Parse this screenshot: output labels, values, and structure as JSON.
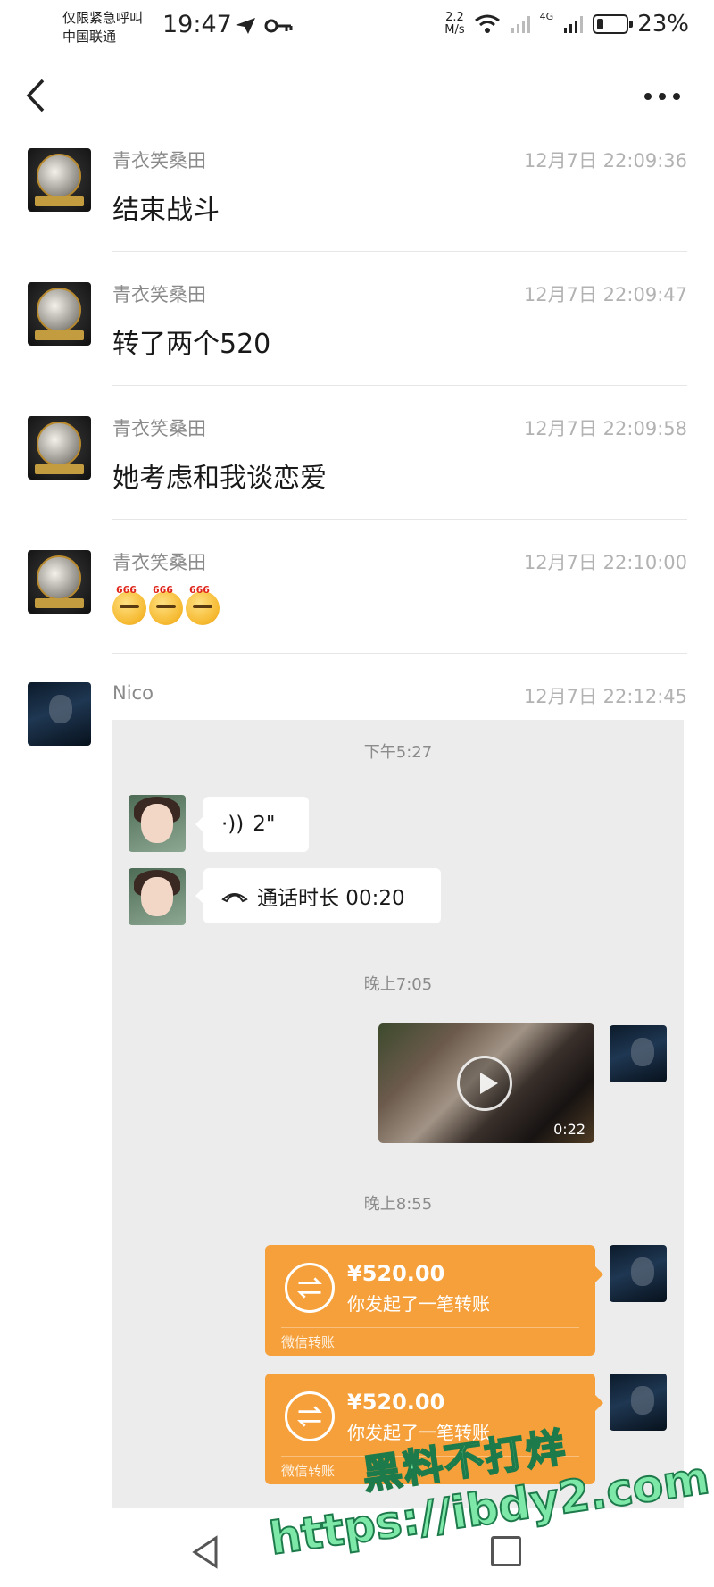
{
  "status_bar": {
    "carrier_line1": "仅限紧急呼叫",
    "carrier_line2": "中国联通",
    "time": "19:47",
    "net_speed_value": "2.2",
    "net_speed_unit": "M/s",
    "network": "4G",
    "battery": "23%",
    "battery_level": 0.23
  },
  "header": {
    "back_icon": "chevron-left-icon",
    "more_icon": "more-horizontal-icon"
  },
  "messages": [
    {
      "sender": "青衣笑桑田",
      "time": "12月7日 22:09:36",
      "text": "结束战斗",
      "avatar": "trophy-avatar"
    },
    {
      "sender": "青衣笑桑田",
      "time": "12月7日 22:09:47",
      "text": "转了两个520",
      "avatar": "trophy-avatar"
    },
    {
      "sender": "青衣笑桑田",
      "time": "12月7日 22:09:58",
      "text": "她考虑和我谈恋爱",
      "avatar": "trophy-avatar"
    },
    {
      "sender": "青衣笑桑田",
      "time": "12月7日 22:10:00",
      "emoji_label": "666",
      "emoji_count": 3,
      "avatar": "trophy-avatar"
    },
    {
      "sender": "Nico",
      "time": "12月7日 22:12:45",
      "avatar": "dark-avatar"
    }
  ],
  "embedded_chat": {
    "time_1": "下午5:27",
    "voice_duration": "2\"",
    "call_text": "通话时长 00:20",
    "time_2": "晚上7:05",
    "video_duration": "0:22",
    "time_3": "晚上8:55",
    "transfers": [
      {
        "amount": "¥520.00",
        "desc": "你发起了一笔转账",
        "footer": "微信转账"
      },
      {
        "amount": "¥520.00",
        "desc": "你发起了一笔转账",
        "footer": "微信转账"
      }
    ]
  },
  "watermark": {
    "line1": "黑料不打烊",
    "line2": "https://ibdy2.com"
  },
  "navbar": {
    "back_icon": "triangle-back-icon",
    "recent_icon": "square-recent-icon"
  }
}
